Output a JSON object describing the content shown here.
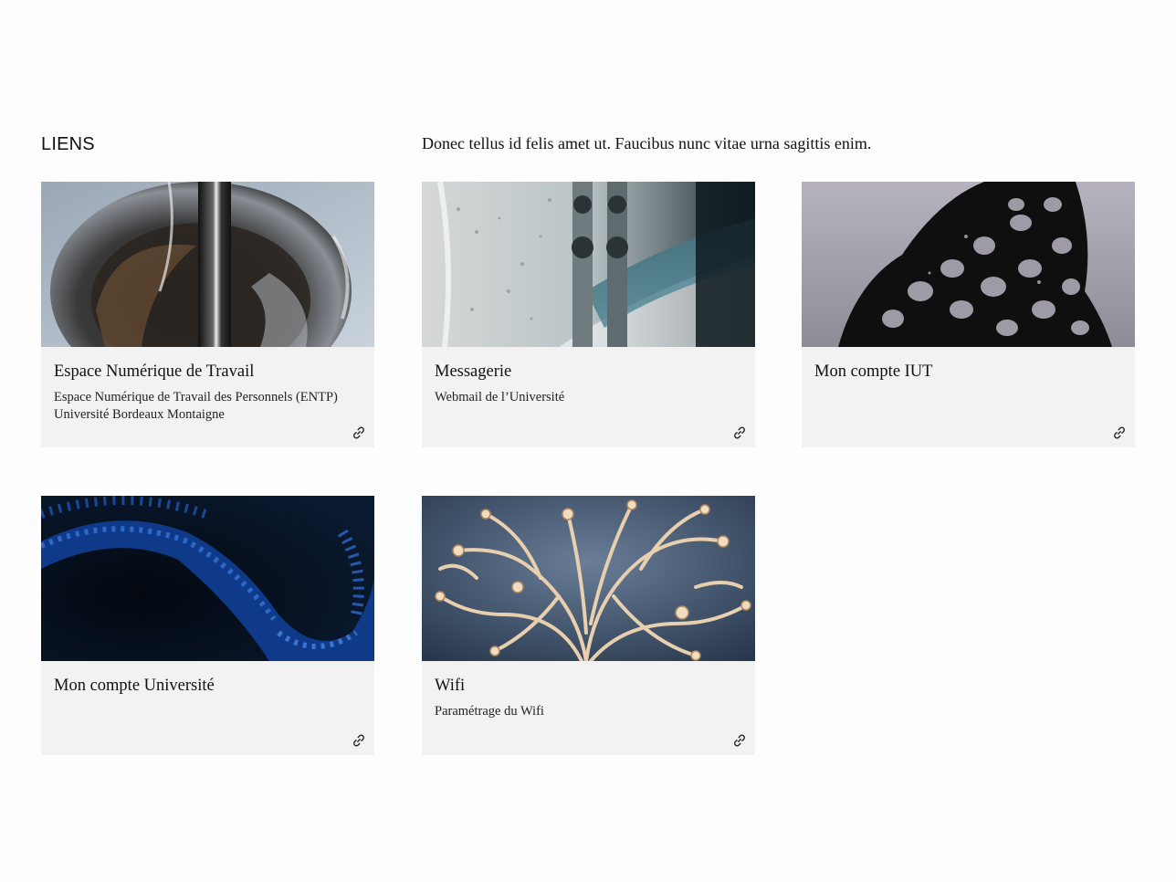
{
  "section": {
    "title": "LIENS",
    "intro": "Donec tellus id felis amet ut. Faucibus nunc vitae urna sagittis enim."
  },
  "cards": [
    {
      "title": "Espace Numérique de Travail",
      "desc_line1": "Espace Numérique de Travail des Personnels (ENTP)",
      "desc_line2": "Université Bordeaux Montaigne",
      "icon": "link-icon",
      "image": "chrome-swirl-image"
    },
    {
      "title": "Messagerie",
      "desc_line1": "Webmail de l’Université",
      "icon": "link-icon",
      "image": "glass-droplets-image"
    },
    {
      "title": "Mon compte IUT",
      "icon": "link-icon",
      "image": "black-lattice-image"
    },
    {
      "title": "Mon compte Université",
      "icon": "link-icon",
      "image": "blue-spiky-coil-image"
    },
    {
      "title": "Wifi",
      "desc_line1": "Paramétrage du Wifi",
      "icon": "link-icon",
      "image": "cream-tendrils-image"
    }
  ],
  "colors": {
    "card_background": "#f2f2f2",
    "page_background": "#fdfdfd",
    "text": "#111111"
  }
}
